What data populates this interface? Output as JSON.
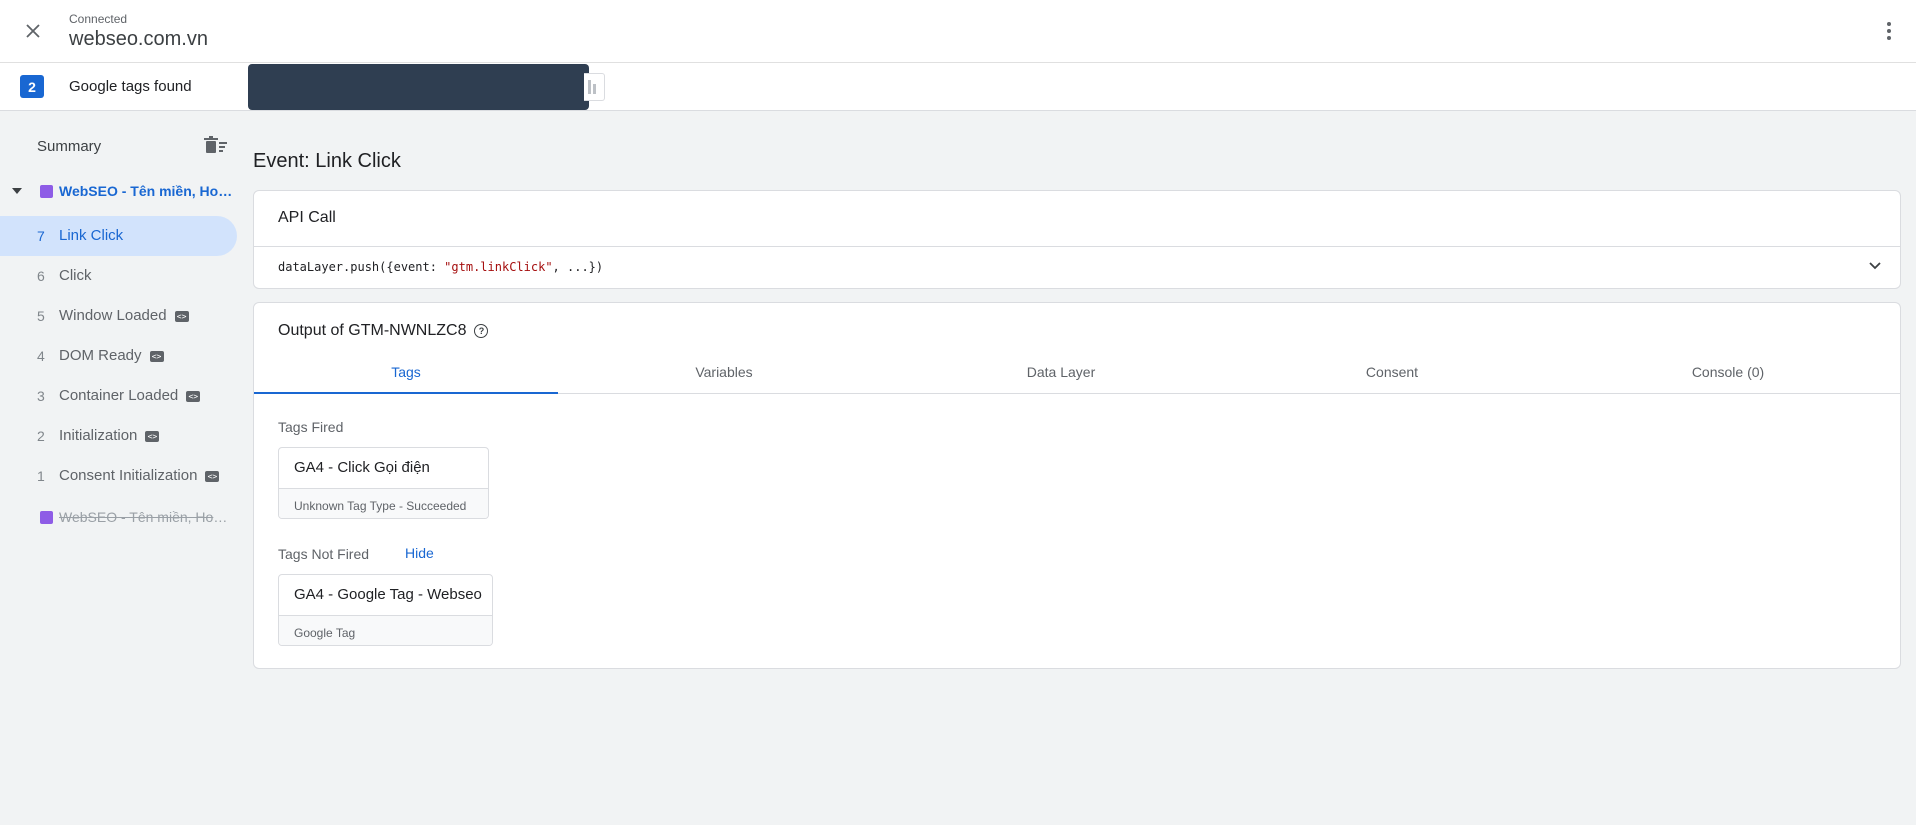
{
  "header": {
    "status": "Connected",
    "domain": "webseo.com.vn"
  },
  "tags_bar": {
    "count": "2",
    "label": "Google tags found"
  },
  "sidebar": {
    "summary": "Summary",
    "container": "WebSEO - Tên miền, Hosting, Domain",
    "events": [
      {
        "num": "7",
        "name": "Link Click",
        "active": true,
        "code_badge": false
      },
      {
        "num": "6",
        "name": "Click",
        "active": false,
        "code_badge": false
      },
      {
        "num": "5",
        "name": "Window Loaded",
        "active": false,
        "code_badge": true
      },
      {
        "num": "4",
        "name": "DOM Ready",
        "active": false,
        "code_badge": true
      },
      {
        "num": "3",
        "name": "Container Loaded",
        "active": false,
        "code_badge": true
      },
      {
        "num": "2",
        "name": "Initialization",
        "active": false,
        "code_badge": true
      },
      {
        "num": "1",
        "name": "Consent Initialization",
        "active": false,
        "code_badge": true
      }
    ],
    "container2": "WebSEO - Tên miền, Hosting, Domain"
  },
  "main": {
    "event_title": "Event: Link Click",
    "api_call": {
      "title": "API Call",
      "code_prefix": "dataLayer.push({event: ",
      "code_string": "\"gtm.linkClick\"",
      "code_suffix": ", ...})"
    },
    "output": {
      "title": "Output of GTM-NWNLZC8",
      "tabs": [
        "Tags",
        "Variables",
        "Data Layer",
        "Consent",
        "Console (0)"
      ],
      "active_tab": "Tags",
      "tags_fired_label": "Tags Fired",
      "tags_fired": [
        {
          "name": "GA4 - Click Gọi điện",
          "sub": "Unknown Tag Type - Succeeded"
        }
      ],
      "tags_not_fired_label": "Tags Not Fired",
      "hide_label": "Hide",
      "tags_not_fired": [
        {
          "name": "GA4 - Google Tag - Webseo",
          "sub": "Google Tag"
        }
      ]
    }
  },
  "colors": {
    "accent": "#1967d2",
    "container_square": "#8e5ce6",
    "redacted": "#2f3e51"
  }
}
